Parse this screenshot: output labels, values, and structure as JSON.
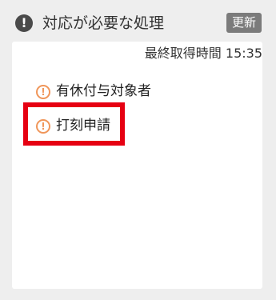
{
  "header": {
    "icon": "exclamation-circle-icon",
    "title": "対応が必要な処理",
    "refresh_label": "更新"
  },
  "panel": {
    "last_fetched_label": "最終取得時間",
    "last_fetched_time": "15:35",
    "items": [
      {
        "icon": "warning-circle-icon",
        "label": "有休付与対象者"
      },
      {
        "icon": "warning-circle-icon",
        "label": "打刻申請"
      }
    ]
  },
  "colors": {
    "accent_warning": "#f0965a",
    "highlight": "#e60012",
    "refresh_button_bg": "#7b7b7b"
  }
}
